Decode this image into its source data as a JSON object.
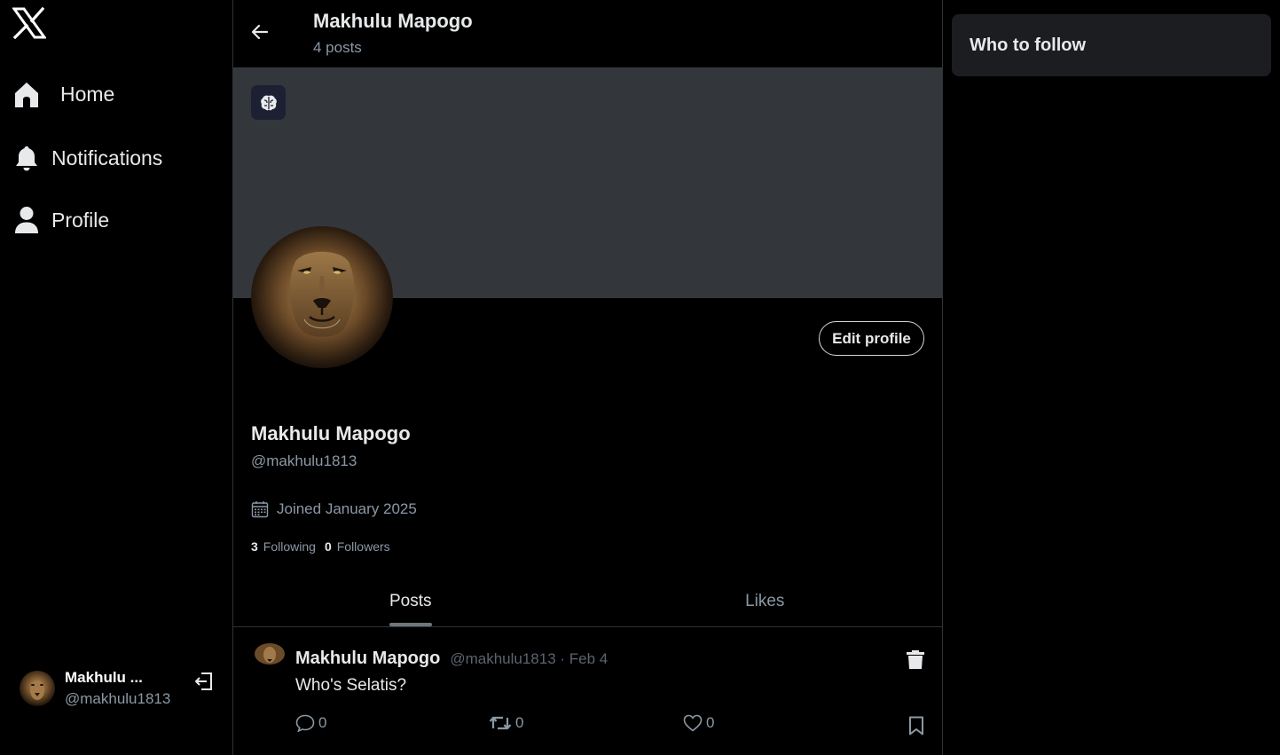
{
  "sidebar": {
    "logo": "x-logo",
    "nav": [
      {
        "label": "Home",
        "icon": "home-icon"
      },
      {
        "label": "Notifications",
        "icon": "bell-icon"
      },
      {
        "label": "Profile",
        "icon": "user-icon"
      }
    ],
    "account": {
      "name": "Makhulu ...",
      "handle": "@makhulu1813",
      "logout_icon": "logout-icon"
    }
  },
  "header": {
    "title": "Makhulu Mapogo",
    "subtitle": "4 posts"
  },
  "profile": {
    "name": "Makhulu Mapogo",
    "handle": "@makhulu1813",
    "joined": "Joined January 2025",
    "edit_label": "Edit profile",
    "following_count": "3",
    "following_label": "Following",
    "followers_count": "0",
    "followers_label": "Followers"
  },
  "tabs": [
    {
      "label": "Posts",
      "active": true
    },
    {
      "label": "Likes",
      "active": false
    }
  ],
  "posts": [
    {
      "name": "Makhulu Mapogo",
      "meta": "@makhulu1813 · Feb 4",
      "text": "Who's Selatis?",
      "replies": "0",
      "reposts": "0",
      "likes": "0"
    }
  ],
  "right": {
    "who_to_follow": "Who to follow"
  },
  "colors": {
    "background": "#000000",
    "banner": "#33363a",
    "muted": "#8b98a5",
    "text": "#e7e9ea",
    "card": "#1c1d21"
  }
}
